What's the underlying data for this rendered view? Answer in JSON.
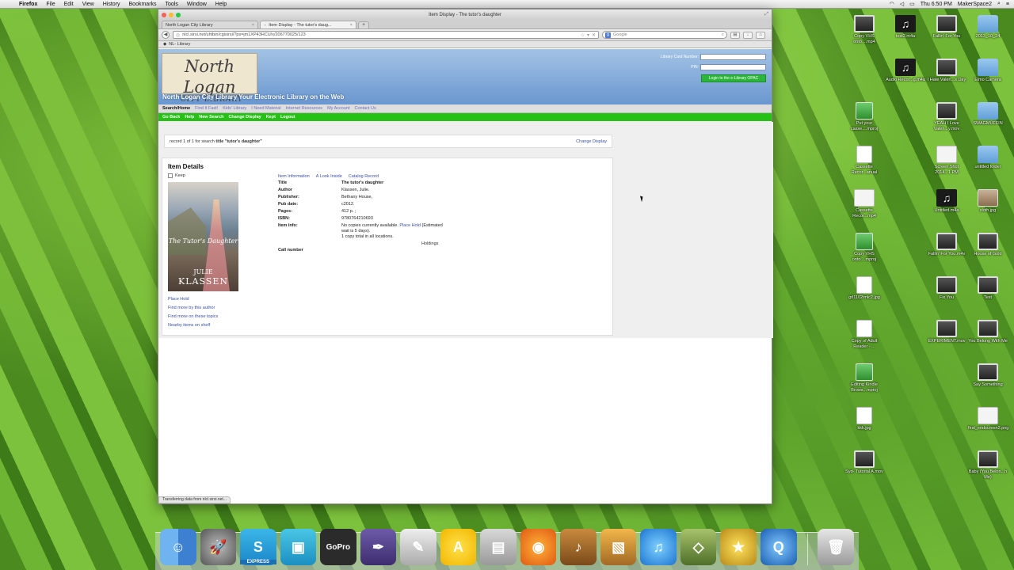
{
  "menubar": {
    "app": "Firefox",
    "items": [
      "File",
      "Edit",
      "View",
      "History",
      "Bookmarks",
      "Tools",
      "Window",
      "Help"
    ],
    "clock": "Thu 6:50 PM",
    "user": "MakerSpace2"
  },
  "window": {
    "title": "Item Display - The tutor's daughter",
    "tabs": [
      {
        "label": "North Logan City Library"
      },
      {
        "label": "Item Display - The tutor's daug..."
      }
    ],
    "url": "nlcl.sirsi.net/uhtbin/cgisirsi/?ps=jm1XP43HCU/x/206770025/123",
    "search_placeholder": "Google",
    "bookmark": "NL- Library",
    "status": "Transferring data from nlcl.sirsi.net..."
  },
  "library": {
    "logo_line1": "North Logan",
    "logo_line2": "CITY LIBRARY",
    "tagline": "North Logan City Library Your Electronic Library on the Web",
    "login": {
      "card_label": "Library Card Number:",
      "pin_label": "PIN:",
      "button": "Login to the e-Library OPAC"
    },
    "nav1": [
      "Search/Home",
      "Find It Fast!",
      "Kids' Library",
      "I Need Material",
      "Internet Resources",
      "My Account",
      "Contact Us"
    ],
    "nav2": [
      "Go Back",
      "Help",
      "New Search",
      "Change Display",
      "Kept",
      "Logout"
    ],
    "record_prefix": "record 1 of 1 for search",
    "record_query": "title \"tutor's daughter\"",
    "change_display": "Change Display",
    "item_details": "Item Details",
    "keep": "Keep",
    "cover": {
      "title": "The Tutor's Daughter",
      "author_first": "JULIE",
      "author_last": "KLASSEN"
    },
    "side_links": [
      "Place Hold",
      "Find more by this author",
      "Find more on these topics",
      "Nearby items on shelf"
    ],
    "detail_tabs": [
      "Item Information",
      "A Look Inside",
      "Catalog Record"
    ],
    "fields": [
      {
        "label": "Title",
        "value": "The tutor's daughter"
      },
      {
        "label": "Author",
        "value": "Klassen, Julie."
      },
      {
        "label": "Publisher:",
        "value": "Bethany House,"
      },
      {
        "label": "Pub date:",
        "value": "c2012."
      },
      {
        "label": "Pages:",
        "value": "412 p. ;"
      },
      {
        "label": "ISBN:",
        "value": "9780764210693"
      }
    ],
    "item_info_label": "Item info:",
    "item_info": {
      "line1_a": "No copies currently available.",
      "line1_link": "Place Hold",
      "line1_b": "(Estimated",
      "line2": "wait is 5 days).",
      "line3": "1 copy total in all locations."
    },
    "holdings": "Holdings",
    "call_number": "Call number"
  },
  "desktop_icons": [
    {
      "label": "Copy VHS onto....mp4",
      "kind": "movie"
    },
    {
      "label": "test2.m4a",
      "kind": "music"
    },
    {
      "label": "Fallin' For You",
      "kind": "movie"
    },
    {
      "label": "2013_10_24",
      "kind": "folder"
    },
    {
      "label": "Audio Recor...g.m4a",
      "kind": "music"
    },
    {
      "label": "I Hate Valen...s Day",
      "kind": "movie"
    },
    {
      "label": "Elmo Camera",
      "kind": "folder"
    },
    {
      "label": "Put your casse....mproj",
      "kind": "proj"
    },
    {
      "label": "YEAH I Love Valen...y.mov",
      "kind": "movie"
    },
    {
      "label": "SWAGMUFFIN",
      "kind": "folder"
    },
    {
      "label": "Cassette Recor...anual",
      "kind": "doc"
    },
    {
      "label": "Screen Shot 2014...1 PM",
      "kind": "shot"
    },
    {
      "label": "untitled folder",
      "kind": "folder"
    },
    {
      "label": "Cassette Recor...mp4",
      "kind": "shot"
    },
    {
      "label": "Untitled.m4a",
      "kind": "music"
    },
    {
      "label": "sloth.jpg",
      "kind": "photo"
    },
    {
      "label": "Copy VHS onto....mproj",
      "kind": "proj"
    },
    {
      "label": "Fallin' For You.m4v",
      "kind": "movie"
    },
    {
      "label": "House of Gold",
      "kind": "movie"
    },
    {
      "label": "grl1102imlc2.jpg",
      "kind": "doc"
    },
    {
      "label": "Fix You",
      "kind": "movie"
    },
    {
      "label": "Test",
      "kind": "movie"
    },
    {
      "label": "Copy of Adult Reader - ...",
      "kind": "doc"
    },
    {
      "label": "EXPERIMENT.mov",
      "kind": "movie"
    },
    {
      "label": "You Belong With Me",
      "kind": "movie"
    },
    {
      "label": "Editing Kindle Brows...mproj",
      "kind": "proj"
    },
    {
      "label": "Say Something",
      "kind": "movie"
    },
    {
      "label": "kkk.jpg",
      "kind": "doc"
    },
    {
      "label": "first_endscreen2.png",
      "kind": "shot"
    },
    {
      "label": "Syd- Tutorial A.mov",
      "kind": "movie"
    },
    {
      "label": "Baby (You Belon...h Me)",
      "kind": "movie"
    }
  ],
  "dock": {
    "apps": [
      "finder",
      "launchpad",
      "express",
      "preview",
      "gopro",
      "quill",
      "brush",
      "a-app",
      "photo-booth",
      "firefox",
      "guitar",
      "iphoto",
      "itunes",
      "cube",
      "imovie",
      "quicktime",
      "trash"
    ],
    "express_label": "EXPRESS",
    "gopro_label": "GoPro"
  }
}
